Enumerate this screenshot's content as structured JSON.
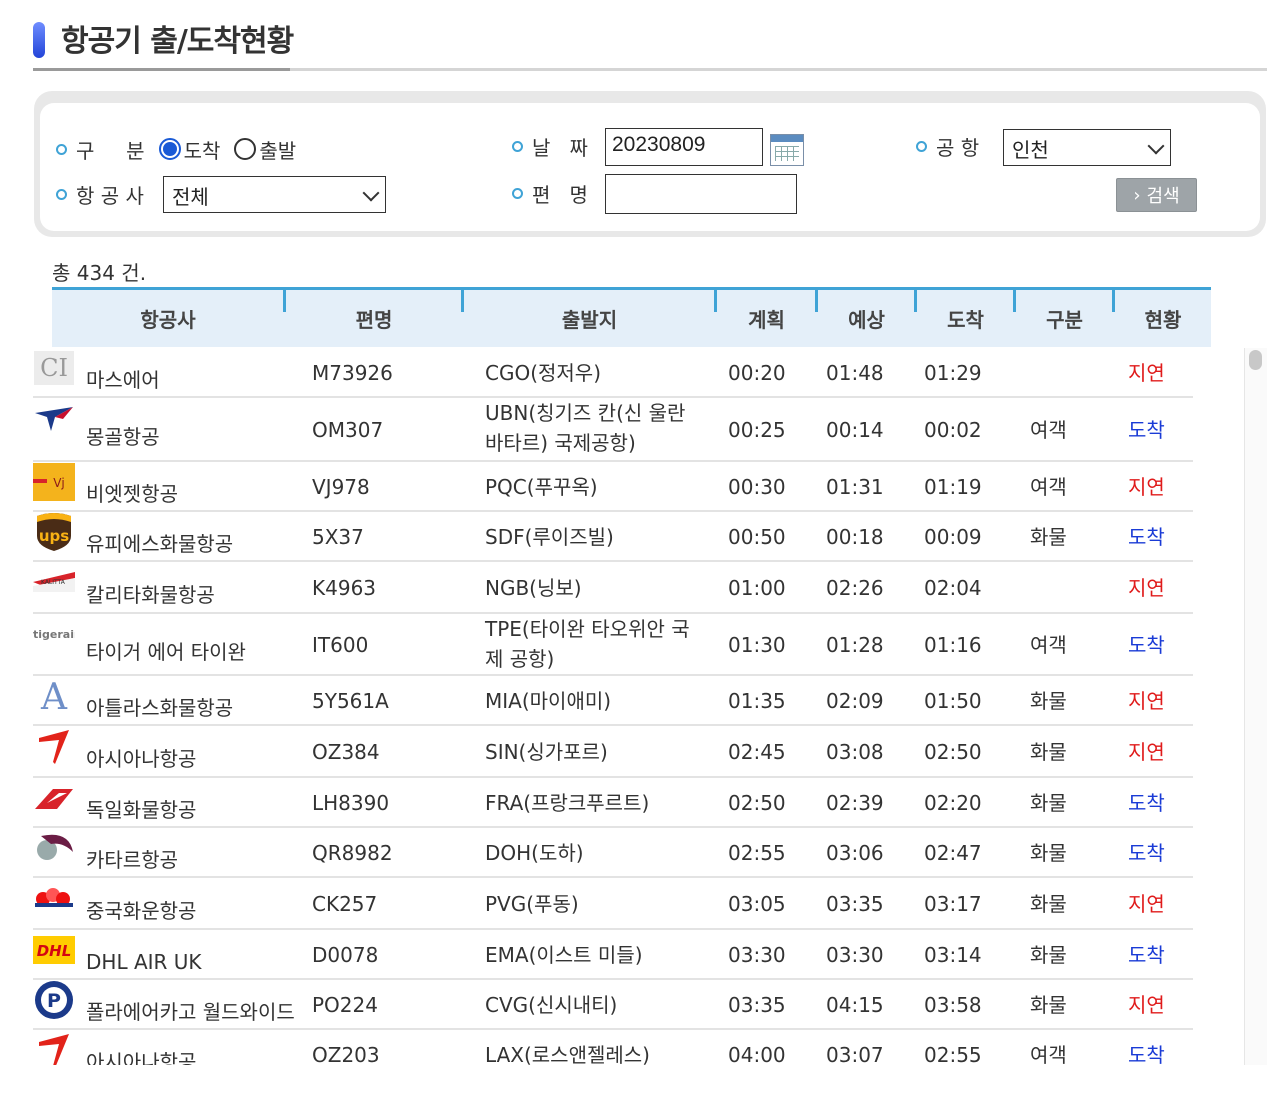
{
  "page": {
    "title": "항공기 출/도착현황"
  },
  "search": {
    "type_label": "구     분",
    "type_options": [
      {
        "label": "도착",
        "selected": true
      },
      {
        "label": "출발",
        "selected": false
      }
    ],
    "date_label": "날   짜",
    "date_value": "20230809",
    "airport_label": "공 항",
    "airport_value": "인천",
    "airline_label": "항 공 사",
    "airline_value": "전체",
    "flight_label": "편   명",
    "flight_value": "",
    "search_button": "검색",
    "search_arrow": "›"
  },
  "total": "총 434 건.",
  "table": {
    "headers": [
      "항공사",
      "편명",
      "출발지",
      "계획",
      "예상",
      "도착",
      "구분",
      "현황"
    ],
    "rows": [
      {
        "logo": "CI",
        "airline": "마스에어",
        "flight": "M73926",
        "origin": "CGO(정저우)",
        "planned": "00:20",
        "expected": "01:48",
        "actual": "01:29",
        "type": "",
        "status": "지연",
        "status_kind": "delay"
      },
      {
        "logo": "",
        "airline": "몽골항공",
        "flight": "OM307",
        "origin": "UBN(칭기즈 칸(신 울란 바타르) 국제공항)",
        "planned": "00:25",
        "expected": "00:14",
        "actual": "00:02",
        "type": "여객",
        "status": "도착",
        "status_kind": "arrive"
      },
      {
        "logo": "",
        "airline": "비엣젯항공",
        "flight": "VJ978",
        "origin": "PQC(푸꾸옥)",
        "planned": "00:30",
        "expected": "01:31",
        "actual": "01:19",
        "type": "여객",
        "status": "지연",
        "status_kind": "delay"
      },
      {
        "logo": "ups",
        "airline": "유피에스화물항공",
        "flight": "5X37",
        "origin": "SDF(루이즈빌)",
        "planned": "00:50",
        "expected": "00:18",
        "actual": "00:09",
        "type": "화물",
        "status": "도착",
        "status_kind": "arrive"
      },
      {
        "logo": "",
        "airline": "칼리타화물항공",
        "flight": "K4963",
        "origin": "NGB(닝보)",
        "planned": "01:00",
        "expected": "02:26",
        "actual": "02:04",
        "type": "",
        "status": "지연",
        "status_kind": "delay"
      },
      {
        "logo": "tigerair",
        "airline": "타이거 에어 타이완",
        "flight": "IT600",
        "origin": "TPE(타이완 타오위안 국제 공항)",
        "planned": "01:30",
        "expected": "01:28",
        "actual": "01:16",
        "type": "여객",
        "status": "도착",
        "status_kind": "arrive"
      },
      {
        "logo": "A",
        "airline": "아틀라스화물항공",
        "flight": "5Y561A",
        "origin": "MIA(마이애미)",
        "planned": "01:35",
        "expected": "02:09",
        "actual": "01:50",
        "type": "화물",
        "status": "지연",
        "status_kind": "delay"
      },
      {
        "logo": "",
        "airline": "아시아나항공",
        "flight": "OZ384",
        "origin": "SIN(싱가포르)",
        "planned": "02:45",
        "expected": "03:08",
        "actual": "02:50",
        "type": "화물",
        "status": "지연",
        "status_kind": "delay"
      },
      {
        "logo": "",
        "airline": "독일화물항공",
        "flight": "LH8390",
        "origin": "FRA(프랑크푸르트)",
        "planned": "02:50",
        "expected": "02:39",
        "actual": "02:20",
        "type": "화물",
        "status": "도착",
        "status_kind": "arrive"
      },
      {
        "logo": "",
        "airline": "카타르항공",
        "flight": "QR8982",
        "origin": "DOH(도하)",
        "planned": "02:55",
        "expected": "03:06",
        "actual": "02:47",
        "type": "화물",
        "status": "도착",
        "status_kind": "arrive"
      },
      {
        "logo": "",
        "airline": "중국화운항공",
        "flight": "CK257",
        "origin": "PVG(푸동)",
        "planned": "03:05",
        "expected": "03:35",
        "actual": "03:17",
        "type": "화물",
        "status": "지연",
        "status_kind": "delay"
      },
      {
        "logo": "DHL",
        "airline": "DHL AIR UK",
        "flight": "D0078",
        "origin": "EMA(이스트 미들)",
        "planned": "03:30",
        "expected": "03:30",
        "actual": "03:14",
        "type": "화물",
        "status": "도착",
        "status_kind": "arrive"
      },
      {
        "logo": "P",
        "airline": "폴라에어카고 월드와이드",
        "flight": "PO224",
        "origin": "CVG(신시내티)",
        "planned": "03:35",
        "expected": "04:15",
        "actual": "03:58",
        "type": "화물",
        "status": "지연",
        "status_kind": "delay"
      },
      {
        "logo": "",
        "airline": "아시아나항공",
        "flight": "OZ203",
        "origin": "LAX(로스앤젤레스)",
        "planned": "04:00",
        "expected": "03:07",
        "actual": "02:55",
        "type": "여객",
        "status": "도착",
        "status_kind": "arrive"
      }
    ]
  },
  "colors": {
    "accent": "#3fa3d6",
    "delay": "#e01b1b",
    "arrive": "#1a3bd6",
    "header_bg": "#e4eff9"
  },
  "logo_icons": [
    "ci-logo-icon",
    "mongolian-logo-icon",
    "vietjet-logo-icon",
    "ups-logo-icon",
    "kalitta-logo-icon",
    "tigerair-logo-icon",
    "atlas-logo-icon",
    "asiana-logo-icon",
    "lufthansa-logo-icon",
    "qatar-logo-icon",
    "china-cargo-logo-icon",
    "dhl-logo-icon",
    "polar-logo-icon",
    "asiana-logo-icon"
  ]
}
